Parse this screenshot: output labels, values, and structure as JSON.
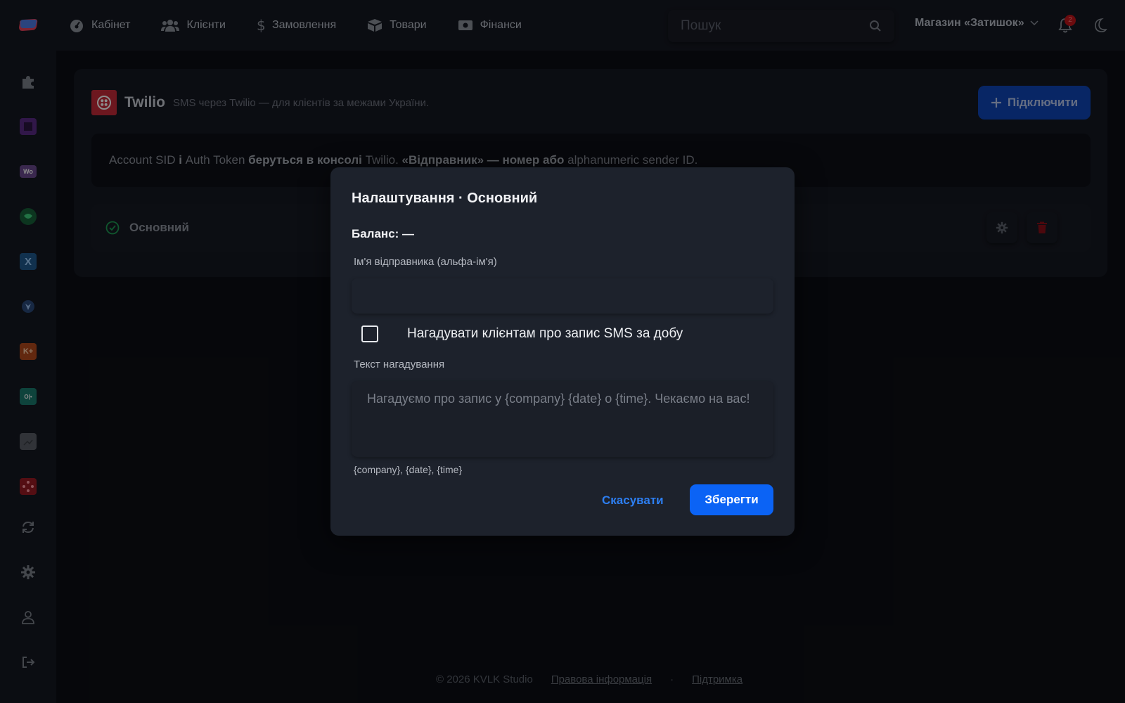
{
  "topbar": {
    "nav": [
      {
        "label": "Кабінет",
        "icon": "dashboard-icon"
      },
      {
        "label": "Клієнти",
        "icon": "users-icon"
      },
      {
        "label": "Замовлення",
        "icon": "dollar-icon"
      },
      {
        "label": "Товари",
        "icon": "box-icon"
      },
      {
        "label": "Фінанси",
        "icon": "money-icon"
      }
    ],
    "search_placeholder": "Пошук",
    "store_label": "Магазин «Затишок»",
    "notification_count": "2"
  },
  "sidebar": {
    "items": [
      {
        "icon": "puzzle-icon"
      },
      {
        "icon": "square-app-icon"
      },
      {
        "icon": "woo-icon",
        "text": "Wo"
      },
      {
        "icon": "green-app-icon"
      },
      {
        "icon": "x-app-icon",
        "text": "X"
      },
      {
        "icon": "shield-app-icon"
      },
      {
        "icon": "k-plus-icon",
        "text": "K+"
      },
      {
        "icon": "teal-app-icon",
        "text": "O|•"
      },
      {
        "icon": "gray-app-icon"
      },
      {
        "icon": "red-app-icon"
      },
      {
        "icon": "sync-icon"
      },
      {
        "icon": "gear-icon"
      },
      {
        "icon": "user-icon"
      },
      {
        "icon": "logout-icon"
      }
    ]
  },
  "card": {
    "title": "Twilio",
    "subtitle": "SMS через Twilio — для клієнтів за межами України.",
    "connect_label": "Підключити",
    "info": {
      "p1": "Account SID ",
      "p2": "і",
      "p3": " Auth Token ",
      "p4": "беруться в консолі",
      "p5": " Twilio. ",
      "p6": "«Відправник» — номер або",
      "p7": " alphanumeric sender ID."
    },
    "account_name": "Основний"
  },
  "modal": {
    "title": "Налаштування · Основний",
    "balance": "Баланс: —",
    "sender_label": "Ім'я відправника (альфа-ім'я)",
    "sender_value": "",
    "reminder_checkbox_label": "Нагадувати клієнтам про запис SMS за добу",
    "reminder_checked": false,
    "reminder_text_label": "Текст нагадування",
    "reminder_placeholder": "Нагадуємо про запис у {company} {date} о {time}. Чекаємо на вас!",
    "variables_hint": "{company}, {date}, {time}",
    "cancel_label": "Скасувати",
    "save_label": "Зберегти"
  },
  "footer": {
    "copyright": "© 2026 KVLK Studio",
    "legal_link": "Правова інформація",
    "separator": "·",
    "support_link": "Підтримка"
  },
  "colors": {
    "background": "#0c0e14",
    "panel": "#151821",
    "modal": "#1d222c",
    "primary": "#0b63f5",
    "link": "#2d7ff2",
    "danger": "#c4141b",
    "success": "#1e9e55",
    "twilio": "#c62a39"
  }
}
